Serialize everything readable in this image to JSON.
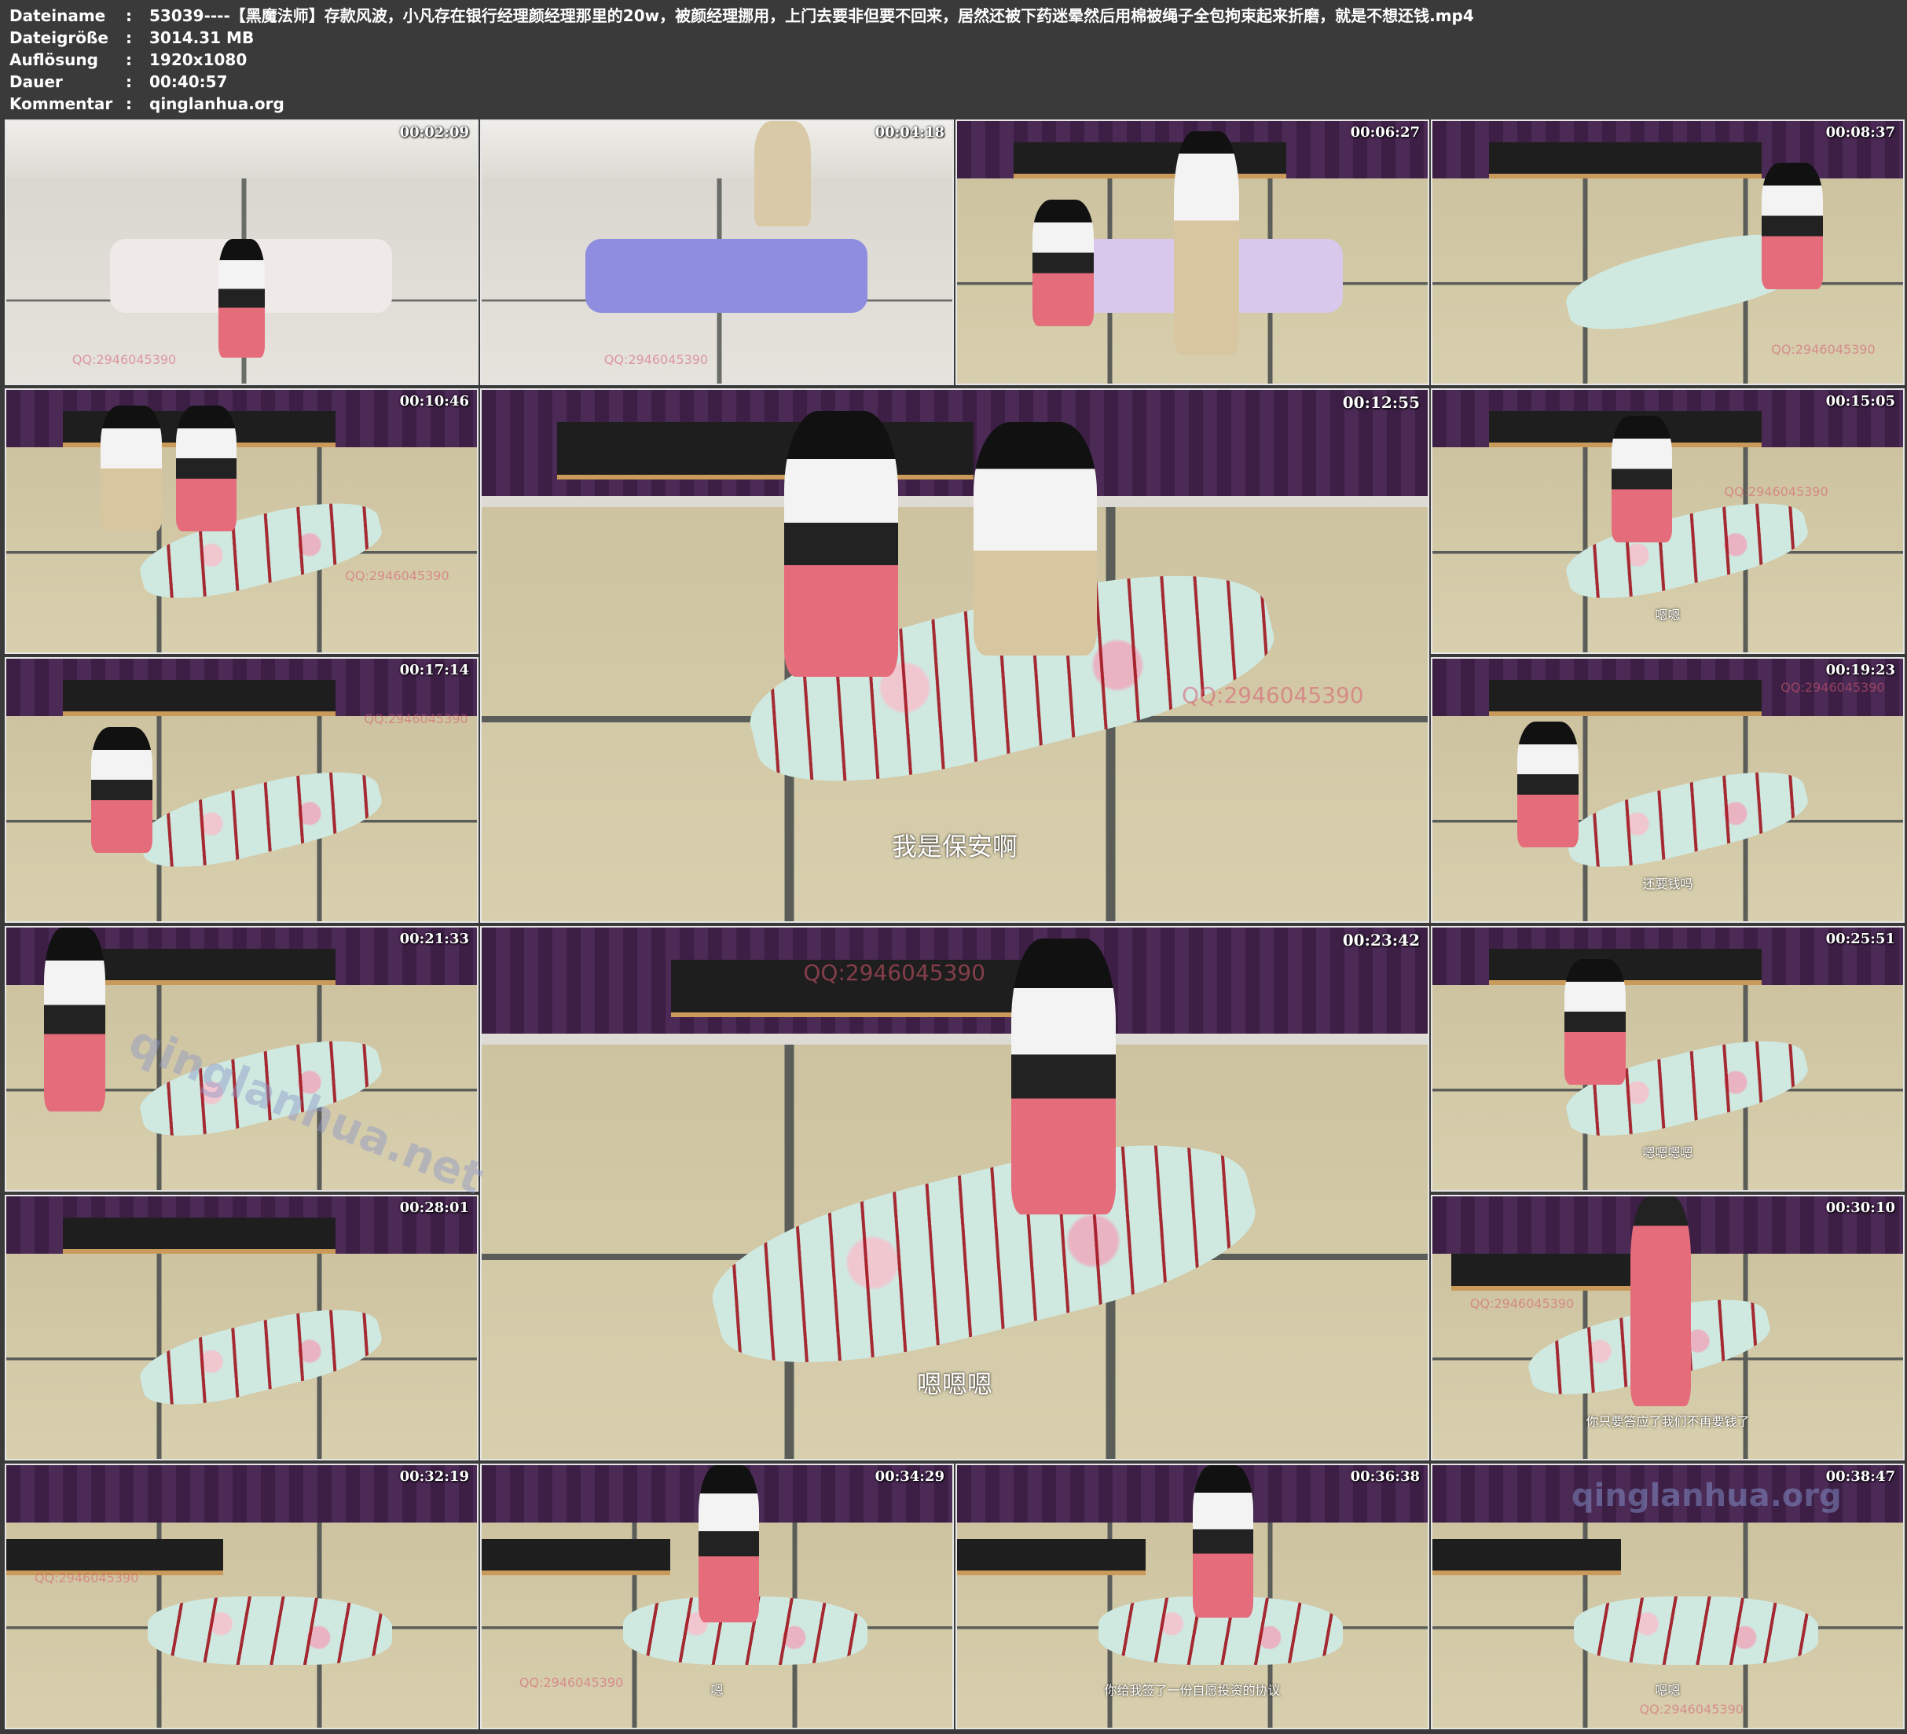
{
  "meta": {
    "rows": [
      {
        "key": "Dateiname",
        "sep": ":",
        "value": "53039----【黑魔法师】存款风波，小凡存在银行经理颜经理那里的20w，被颜经理挪用，上门去要非但要不回来，居然还被下药迷晕然后用棉被绳子全包拘束起来折磨，就是不想还钱.mp4"
      },
      {
        "key": "Dateigröße",
        "sep": ":",
        "value": "3014.31 MB"
      },
      {
        "key": "Auflösung",
        "sep": ":",
        "value": "1920x1080"
      },
      {
        "key": "Dauer",
        "sep": ":",
        "value": "00:40:57"
      },
      {
        "key": "Kommentar",
        "sep": ":",
        "value": "qinglanhua.org"
      }
    ]
  },
  "thumbnails": [
    {
      "time": "00:02:09",
      "subtitle": "",
      "watermark": "QQ:2946045390"
    },
    {
      "time": "00:04:18",
      "subtitle": "",
      "watermark": "QQ:2946045390"
    },
    {
      "time": "00:06:27",
      "subtitle": "",
      "watermark": ""
    },
    {
      "time": "00:08:37",
      "subtitle": "",
      "watermark": "QQ:2946045390"
    },
    {
      "time": "00:10:46",
      "subtitle": "",
      "watermark": "QQ:2946045390"
    },
    {
      "time": "00:12:55",
      "subtitle": "我是保安啊",
      "watermark": "QQ:2946045390"
    },
    {
      "time": "00:15:05",
      "subtitle": "嗯嗯",
      "watermark": "QQ:2946045390"
    },
    {
      "time": "00:17:14",
      "subtitle": "",
      "watermark": "QQ:2946045390"
    },
    {
      "time": "00:19:23",
      "subtitle": "还要钱吗",
      "watermark": "QQ:2946045390"
    },
    {
      "time": "00:21:33",
      "subtitle": "",
      "watermark": ""
    },
    {
      "time": "00:23:42",
      "subtitle": "嗯嗯嗯",
      "watermark": "QQ:2946045390"
    },
    {
      "time": "00:25:51",
      "subtitle": "嗯嗯嗯嗯",
      "watermark": ""
    },
    {
      "time": "00:28:01",
      "subtitle": "",
      "watermark": ""
    },
    {
      "time": "00:30:10",
      "subtitle": "你只要答应了我们不再要钱了",
      "watermark": "QQ:2946045390"
    },
    {
      "time": "00:32:19",
      "subtitle": "",
      "watermark": "QQ:2946045390"
    },
    {
      "time": "00:34:29",
      "subtitle": "嗯",
      "watermark": "QQ:2946045390"
    },
    {
      "time": "00:36:38",
      "subtitle": "你给我签了一份自愿投资的协议",
      "watermark": ""
    },
    {
      "time": "00:38:47",
      "subtitle": "嗯嗯",
      "watermark": "QQ:2946045390"
    }
  ],
  "overlay_watermarks": [
    "qinglanhua.net",
    "qinglanhua.org"
  ]
}
